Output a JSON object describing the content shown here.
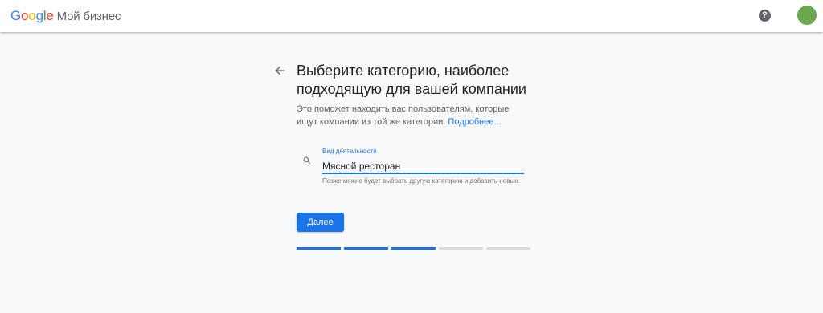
{
  "header": {
    "logo_letters": [
      {
        "char": "G",
        "color": "#4285f4"
      },
      {
        "char": "o",
        "color": "#ea4335"
      },
      {
        "char": "o",
        "color": "#fbbc05"
      },
      {
        "char": "g",
        "color": "#4285f4"
      },
      {
        "char": "l",
        "color": "#34a853"
      },
      {
        "char": "e",
        "color": "#ea4335"
      }
    ],
    "product_name": "Мой бизнес",
    "help_icon": "?"
  },
  "main": {
    "title": "Выберите категорию, наиболее подходящую для вашей компании",
    "subtitle": "Это поможет находить вас пользователям, которые ищут компании из той же категории.",
    "learn_more": "Подробнее...",
    "field": {
      "label": "Вид деятельности",
      "value": "Мясной ресторан"
    },
    "helper_text": "Позже можно будет выбрать другую категорию и добавить новые.",
    "next_button": "Далее",
    "progress": {
      "total_steps": 5,
      "completed_steps": 3
    }
  },
  "colors": {
    "accent": "#1a73e8",
    "avatar": "#6aa84f"
  }
}
